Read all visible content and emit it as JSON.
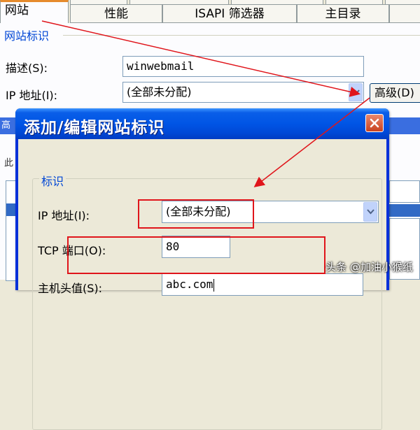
{
  "tabs": {
    "row1": [
      "网站",
      "ISAPI 筛选器",
      "主目录"
    ],
    "active": "网站",
    "items": [
      "性能",
      "ISAPI 筛选器",
      "主目录"
    ]
  },
  "site_group": {
    "title": "网站标识",
    "description_label": "描述(S):",
    "description_value": "winwebmail",
    "ip_label": "IP 地址(I):",
    "ip_value": "(全部未分配)",
    "advanced_button": "高级(D)"
  },
  "dialog": {
    "title": "添加/编辑网站标识",
    "group_title": "标识",
    "ip_label": "IP 地址(I):",
    "ip_value": "(全部未分配)",
    "tcp_label": "TCP 端口(O):",
    "tcp_value": "80",
    "host_label": "主机头值(S):",
    "host_value": "abc.com"
  },
  "background_fragments": {
    "bar_text": "高",
    "label_text": "此"
  },
  "watermark": "头条 @加油小猴纸",
  "colors": {
    "annotation_red": "#e0151b",
    "titlebar_blue": "#0055e5",
    "group_title_blue": "#0046d5"
  }
}
